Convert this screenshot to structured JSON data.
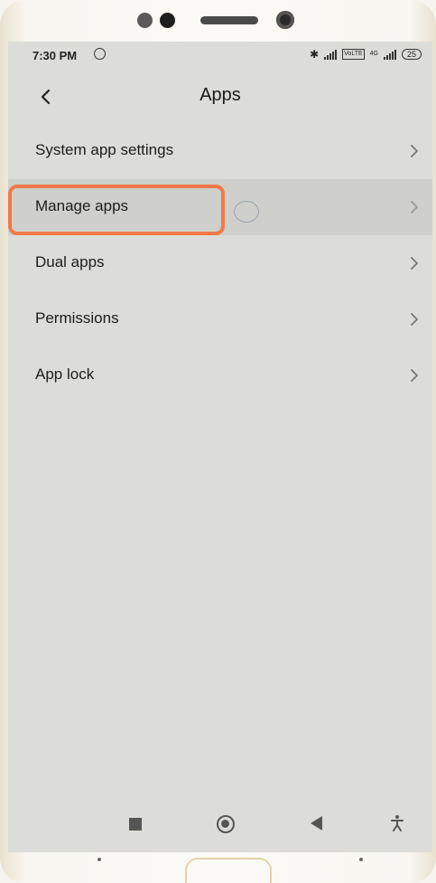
{
  "status": {
    "time": "7:30 PM",
    "network": "4G",
    "volte": "VoLTE",
    "battery": "25"
  },
  "header": {
    "title": "Apps"
  },
  "list": {
    "items": [
      {
        "label": "System app settings"
      },
      {
        "label": "Manage apps"
      },
      {
        "label": "Dual apps"
      },
      {
        "label": "Permissions"
      },
      {
        "label": "App lock"
      }
    ]
  },
  "colors": {
    "highlight": "#f2794a",
    "screen_bg": "#dcddd8"
  },
  "icons": [
    "back-arrow-icon",
    "chevron-right-icon",
    "alarm-icon",
    "bluetooth-icon",
    "signal-icon",
    "battery-icon",
    "recent-apps-icon",
    "home-icon",
    "back-icon",
    "accessibility-icon"
  ]
}
